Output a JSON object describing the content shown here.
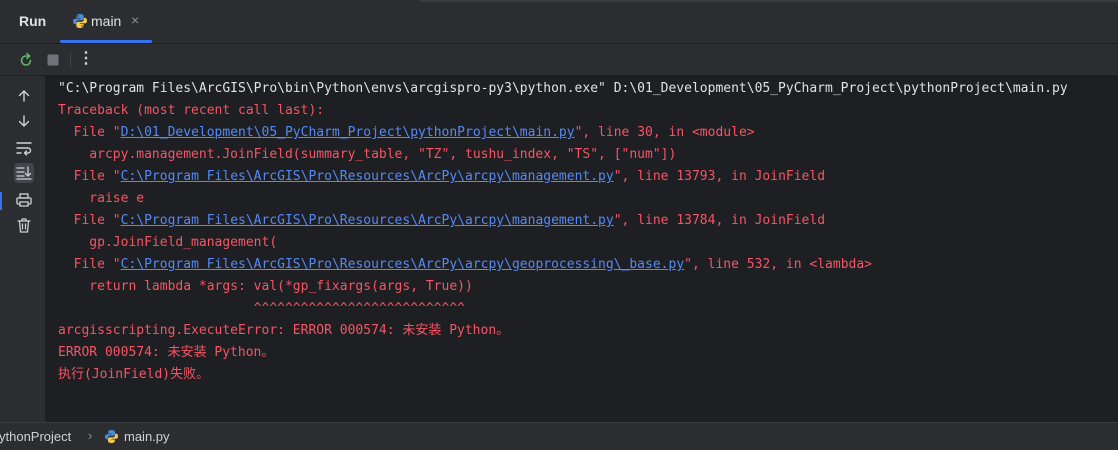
{
  "toolwindow": {
    "title": "Run",
    "tab": {
      "label": "main",
      "close": "×",
      "icon": "python-file-icon"
    }
  },
  "toolbar": {
    "rerun_icon": "rerun-icon",
    "stop_icon": "stop-icon",
    "more": "⋮"
  },
  "sidebar": {
    "items": [
      "up-arrow-icon",
      "down-arrow-icon",
      "soft-wrap-icon",
      "scroll-to-end-icon",
      "print-icon",
      "trash-icon"
    ]
  },
  "console": {
    "lines": [
      {
        "style": "normal",
        "parts": [
          {
            "t": "\"C:\\Program Files\\ArcGIS\\Pro\\bin\\Python\\envs\\arcgispro-py3\\python.exe\" D:\\01_Development\\05_PyCharm_Project\\pythonProject\\main.py"
          }
        ]
      },
      {
        "style": "err",
        "parts": [
          {
            "t": "Traceback (most recent call last):"
          }
        ]
      },
      {
        "style": "err",
        "parts": [
          {
            "t": "  File \""
          },
          {
            "t": "D:\\01_Development\\05_PyCharm_Project\\pythonProject\\main.py",
            "link": true
          },
          {
            "t": "\", line 30, in <module>"
          }
        ]
      },
      {
        "style": "err",
        "parts": [
          {
            "t": "    arcpy.management.JoinField(summary_table, \"TZ\", tushu_index, \"TS\", [\"num\"])"
          }
        ]
      },
      {
        "style": "err",
        "parts": [
          {
            "t": "  File \""
          },
          {
            "t": "C:\\Program Files\\ArcGIS\\Pro\\Resources\\ArcPy\\arcpy\\management.py",
            "link": true
          },
          {
            "t": "\", line 13793, in JoinField"
          }
        ]
      },
      {
        "style": "err",
        "parts": [
          {
            "t": "    raise e"
          }
        ]
      },
      {
        "style": "err",
        "parts": [
          {
            "t": "  File \""
          },
          {
            "t": "C:\\Program Files\\ArcGIS\\Pro\\Resources\\ArcPy\\arcpy\\management.py",
            "link": true
          },
          {
            "t": "\", line 13784, in JoinField"
          }
        ]
      },
      {
        "style": "err",
        "parts": [
          {
            "t": "    gp.JoinField_management("
          }
        ]
      },
      {
        "style": "err",
        "parts": [
          {
            "t": "  File \""
          },
          {
            "t": "C:\\Program Files\\ArcGIS\\Pro\\Resources\\ArcPy\\arcpy\\geoprocessing\\_base.py",
            "link": true
          },
          {
            "t": "\", line 532, in <lambda>"
          }
        ]
      },
      {
        "style": "err",
        "parts": [
          {
            "t": "    return lambda *args: val(*gp_fixargs(args, True))"
          }
        ]
      },
      {
        "style": "err",
        "parts": [
          {
            "t": "                         ^^^^^^^^^^^^^^^^^^^^^^^^^^^"
          }
        ]
      },
      {
        "style": "err",
        "parts": [
          {
            "t": "arcgisscripting.ExecuteError: ERROR 000574: 未安装 Python。"
          }
        ]
      },
      {
        "style": "err",
        "parts": [
          {
            "t": "ERROR 000574: 未安装 Python。"
          }
        ]
      },
      {
        "style": "err",
        "parts": [
          {
            "t": "执行(JoinField)失败。"
          }
        ]
      }
    ]
  },
  "statusbar": {
    "project": "ythonProject",
    "separator": "›",
    "file": "main.py",
    "file_icon": "python-file-icon"
  },
  "colors": {
    "accent": "#3574f0",
    "error_text": "#f75464",
    "link_text": "#548af7",
    "normal_text": "#dfe1e5"
  }
}
